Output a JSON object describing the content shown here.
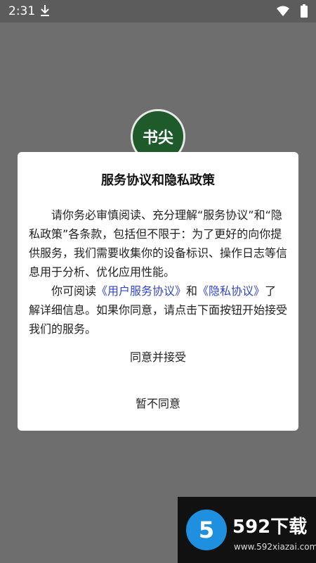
{
  "status_bar": {
    "time": "2:31",
    "icons": [
      "download-icon",
      "wifi-icon",
      "battery-icon"
    ]
  },
  "app_logo_text": "书尖",
  "dialog": {
    "title": "服务协议和隐私政策",
    "paragraph1": "请你务必审慎阅读、充分理解“服务协议”和“隐私政策”各条款，包括但不限于：为了更好的向你提供服务，我们需要收集你的设备标识、操作日志等信息用于分析、优化应用性能。",
    "paragraph2_prefix": "你可阅读",
    "user_agreement_link": "《用户服务协议》",
    "and_text": "和",
    "privacy_link": "《隐私协议》",
    "paragraph2_suffix": "了解详细信息。如果你同意，请点击下面按钮开始接受我们的服务。",
    "agree_button": "同意并接受",
    "disagree_button": "暂不同意"
  },
  "watermark": {
    "badge": "5",
    "title": "592下载",
    "url": "www.592xiazai.com"
  },
  "colors": {
    "overlay": "#6e6e6e",
    "statusbar": "#5c5c5c",
    "link": "#3346c4",
    "logo_green": "#1e5a2a",
    "watermark_blue": "#1f8fe0"
  }
}
